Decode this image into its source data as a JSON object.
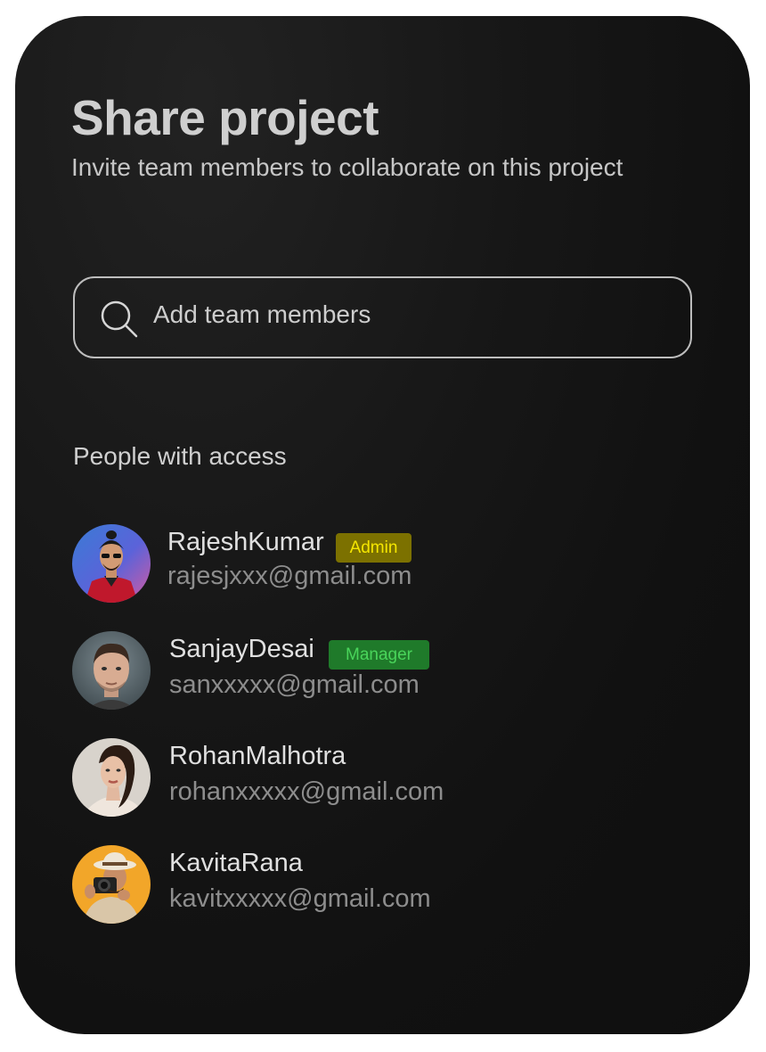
{
  "dialog": {
    "title": "Share project",
    "subtitle": "Invite team members to collaborate on this project"
  },
  "search": {
    "icon": "search-icon",
    "placeholder": "Add team members"
  },
  "access": {
    "label": "People with access",
    "people": [
      {
        "name": "RajeshKumar",
        "email": "rajesjxxx@gmail.com",
        "badge": "Admin",
        "badge_bg": "#7c7100",
        "badge_color": "#f5e600"
      },
      {
        "name": "SanjayDesai",
        "email": "sanxxxxx@gmail.com",
        "badge": "Manager",
        "badge_bg": "#1f7a2a",
        "badge_color": "#49d45a"
      },
      {
        "name": "RohanMalhotra",
        "email": "rohanxxxxx@gmail.com"
      },
      {
        "name": "KavitaRana",
        "email": "kavitxxxxx@gmail.com"
      }
    ]
  }
}
